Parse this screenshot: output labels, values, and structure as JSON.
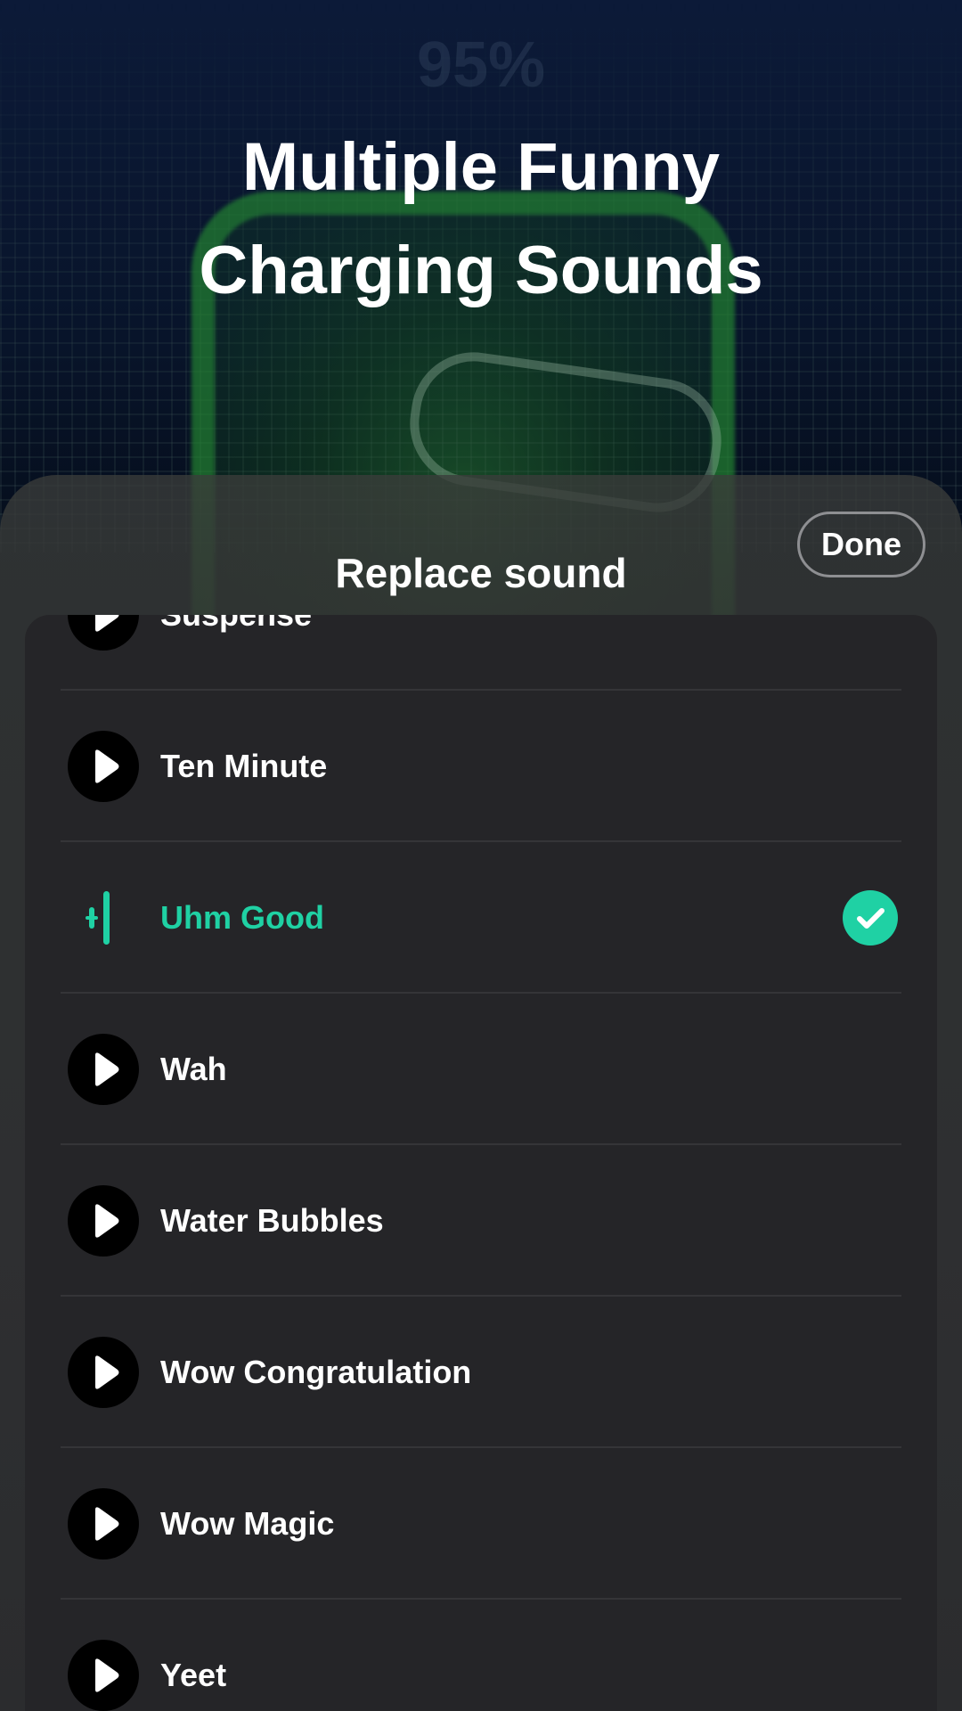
{
  "hero": {
    "percent": "95%",
    "title_line1": "Multiple Funny",
    "title_line2": "Charging Sounds"
  },
  "sheet": {
    "title": "Replace sound",
    "done_label": "Done",
    "selected_item": "Uhm Good",
    "accent_color": "#1fd1a4",
    "items": [
      {
        "label": "Suspense",
        "icon": "play-icon"
      },
      {
        "label": "Ten Minute",
        "icon": "play-icon"
      },
      {
        "label": "Uhm Good",
        "icon": "equalizer-icon",
        "selected": true
      },
      {
        "label": "Wah",
        "icon": "play-icon"
      },
      {
        "label": "Water Bubbles",
        "icon": "play-icon"
      },
      {
        "label": "Wow Congratulation",
        "icon": "play-icon"
      },
      {
        "label": "Wow Magic",
        "icon": "play-icon"
      },
      {
        "label": "Yeet",
        "icon": "play-icon"
      }
    ]
  }
}
